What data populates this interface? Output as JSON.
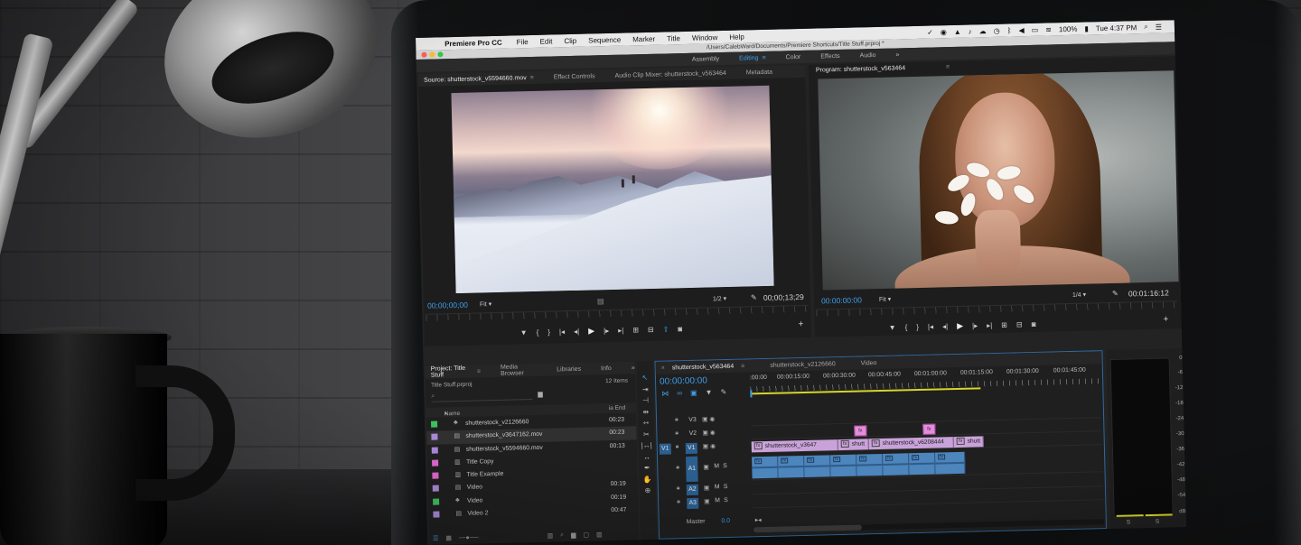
{
  "menubar": {
    "app": "Premiere Pro CC",
    "items": [
      "File",
      "Edit",
      "Clip",
      "Sequence",
      "Marker",
      "Title",
      "Window",
      "Help"
    ],
    "battery": "100%",
    "clock": "Tue 4:37 PM"
  },
  "titlebar": {
    "path": "/Users/CalebWard/Documents/Premiere Shortcuts/Title Stuff.prproj *"
  },
  "workspaces": {
    "items": [
      "Assembly",
      "Editing",
      "Color",
      "Effects",
      "Audio"
    ],
    "active": "Editing",
    "more": "»"
  },
  "source": {
    "tabs": [
      "Source: shutterstock_v5594660.mov",
      "Effect Controls",
      "Audio Clip Mixer: shutterstock_v563464",
      "Metadata"
    ],
    "timecode": "00;00;00;00",
    "fit": "Fit",
    "scale": "1/2",
    "duration": "00;00;13;29"
  },
  "program": {
    "title": "Program: shutterstock_v563464",
    "timecode": "00:00:00:00",
    "fit": "Fit",
    "scale": "1/4",
    "duration": "00:01:16:12"
  },
  "project": {
    "tabs": [
      "Project: Title Stuff",
      "Media Browser",
      "Libraries",
      "Info"
    ],
    "file": "Title Stuff.prproj",
    "count": "12 Items",
    "col_name": "Name",
    "col_end": "ia End",
    "rows": [
      {
        "name": "shutterstock_v2126660",
        "end": "00:23",
        "color": "#3fbf5f",
        "icon": "sequence"
      },
      {
        "name": "shutterstock_v3647162.mov",
        "end": "00:23",
        "color": "#a98ad8",
        "icon": "clip"
      },
      {
        "name": "shutterstock_v5594660.mov",
        "end": "00:13",
        "color": "#a98ad8",
        "icon": "clip"
      },
      {
        "name": "Title Copy",
        "end": "",
        "color": "#e06ad0",
        "icon": "title"
      },
      {
        "name": "Title Example",
        "end": "",
        "color": "#e06ad0",
        "icon": "title"
      },
      {
        "name": "Video",
        "end": "00:19",
        "color": "#a98ad8",
        "icon": "clip"
      },
      {
        "name": "Video",
        "end": "00:19",
        "color": "#3fbf5f",
        "icon": "sequence"
      },
      {
        "name": "Video 2",
        "end": "00:47",
        "color": "#a98ad8",
        "icon": "clip"
      }
    ]
  },
  "timeline": {
    "tabs": [
      "shutterstock_v563464",
      "shutterstock_v2126660",
      "Video"
    ],
    "timecode": "00:00:00:00",
    "ruler": [
      ":00:00",
      "00:00:15:00",
      "00:00:30:00",
      "00:00:45:00",
      "00:01:00:00",
      "00:01:15:00",
      "00:01:30:00",
      "00:01:45:00"
    ],
    "tracks": {
      "v3": "V3",
      "v2": "V2",
      "v1": "V1",
      "v1_src": "V1",
      "a1": "A1",
      "a1_src": "A1",
      "a2": "A2",
      "a3": "A3",
      "mute": "M",
      "solo": "S"
    },
    "clips": {
      "v1_a": "shutterstock_v3647",
      "v1_b": "shutt",
      "v1_c": "shutterstock_v6208444",
      "v1_d": "shutt",
      "fx": "fx"
    },
    "master": {
      "label": "Master",
      "value": "0.0"
    }
  },
  "meters": {
    "scale": [
      "0",
      "-6",
      "-12",
      "-18",
      "-24",
      "-30",
      "-36",
      "-42",
      "-48",
      "-54",
      "dB"
    ],
    "solo_left": "S",
    "solo_right": "S"
  },
  "colors": {
    "accent": "#3d9eea",
    "video_clip": "#c9a2d9",
    "title_clip": "#e48ddc",
    "audio_clip": "#4d85bd"
  }
}
